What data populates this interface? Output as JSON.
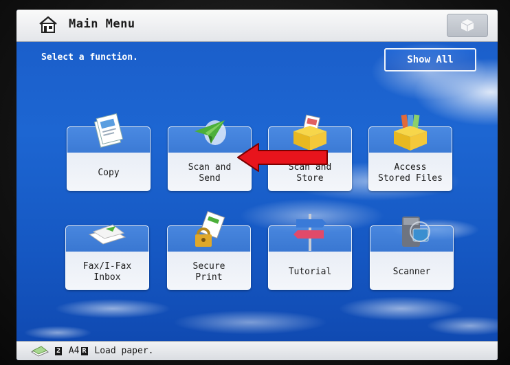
{
  "header": {
    "title": "Main Menu",
    "home_icon": "home-icon",
    "corner_button_icon": "cube-icon"
  },
  "prompt": "Select a function.",
  "show_all_label": "Show All",
  "tiles": [
    {
      "label": "Copy",
      "icon": "copy-icon"
    },
    {
      "label": "Scan and\nSend",
      "icon": "scan-send-icon"
    },
    {
      "label": "Scan and\nStore",
      "icon": "scan-store-icon"
    },
    {
      "label": "Access\nStored Files",
      "icon": "stored-files-icon"
    },
    {
      "label": "Fax/I-Fax\nInbox",
      "icon": "fax-inbox-icon"
    },
    {
      "label": "Secure\nPrint",
      "icon": "secure-print-icon"
    },
    {
      "label": "Tutorial",
      "icon": "tutorial-icon"
    },
    {
      "label": "Scanner",
      "icon": "scanner-icon"
    }
  ],
  "status": {
    "tray": "2",
    "paper": "A4",
    "paper_orient": "R",
    "message": "Load paper."
  },
  "annotation": {
    "type": "arrow",
    "color": "#e8141c",
    "points_to": "Scan and Send"
  },
  "colors": {
    "screen_blue": "#1d66d2",
    "arrow_red": "#e8141c"
  }
}
